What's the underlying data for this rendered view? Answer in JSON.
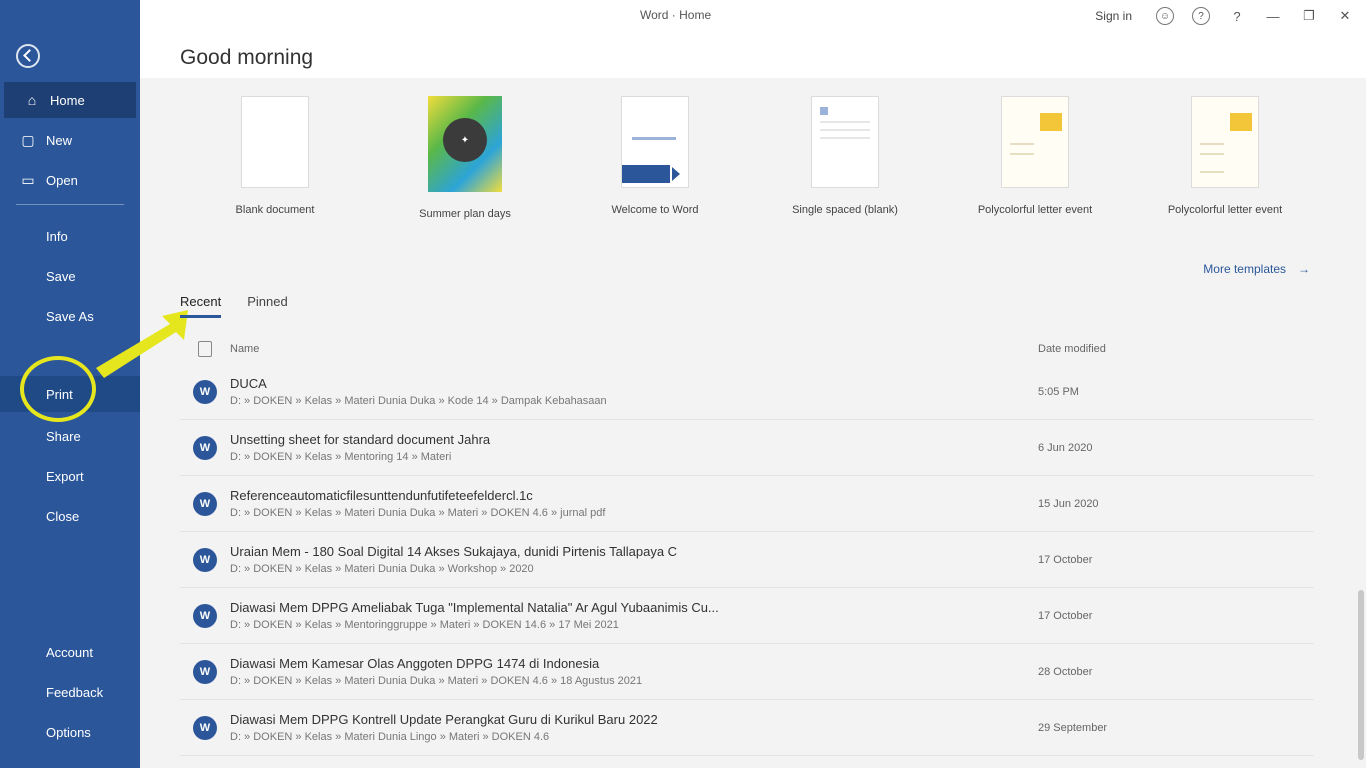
{
  "titlebar": {
    "title": "Word · Home",
    "sign_in": "Sign in",
    "icons": [
      "people-icon",
      "help-circle-icon",
      "feedback-icon",
      "minimize-icon",
      "restore-icon",
      "close-icon"
    ]
  },
  "header": {
    "greeting": "Good morning"
  },
  "sidebar": {
    "items": [
      {
        "label": "Home",
        "icon": "home-icon"
      },
      {
        "label": "New",
        "icon": "new-document-icon"
      },
      {
        "label": "Open",
        "icon": "folder-open-icon"
      },
      {
        "label": "Info"
      },
      {
        "label": "Save"
      },
      {
        "label": "Save As"
      },
      {
        "label": "Print"
      },
      {
        "label": "Share"
      },
      {
        "label": "Export"
      },
      {
        "label": "Close"
      },
      {
        "label": "Account"
      },
      {
        "label": "Feedback"
      },
      {
        "label": "Options"
      }
    ]
  },
  "templates": [
    {
      "label": "Blank document"
    },
    {
      "label": "Summer plan days"
    },
    {
      "label": "Welcome to Word"
    },
    {
      "label": "Single spaced (blank)"
    },
    {
      "label": "Polycolorful letter event"
    },
    {
      "label": "Polycolorful letter event"
    }
  ],
  "more_templates": "More templates",
  "tabs": [
    "Recent",
    "Pinned"
  ],
  "list": {
    "col_name": "Name",
    "col_date": "Date modified",
    "rows": [
      {
        "title": "DUCA",
        "path": "D: » DOKEN » Kelas » Materi Dunia Duka » Kode 14 » Dampak Kebahasaan",
        "date": "5:05 PM"
      },
      {
        "title": "Unsetting sheet for standard document Jahra",
        "path": "D: » DOKEN » Kelas » Mentoring 14 » Materi",
        "date": "6 Jun 2020"
      },
      {
        "title": "Referenceautomaticfilesunttendunfutifeteefeldercl.1c",
        "path": "D: » DOKEN » Kelas » Materi Dunia Duka » Materi » DOKEN 4.6 » jurnal pdf",
        "date": "15 Jun 2020"
      },
      {
        "title": "Uraian Mem - 180 Soal Digital 14 Akses Sukajaya, dunidi Pirtenis Tallapaya C",
        "path": "D: » DOKEN » Kelas » Materi Dunia Duka » Workshop » 2020",
        "date": "17 October"
      },
      {
        "title": "Diawasi Mem DPPG Ameliabak Tuga \"Implemental Natalia\" Ar Agul Yubaanimis Cu...",
        "path": "D: » DOKEN » Kelas » Mentoringgruppe » Materi » DOKEN 14.6 » 17 Mei 2021",
        "date": "17 October"
      },
      {
        "title": "Diawasi Mem Kamesar Olas Anggoten DPPG 1474 di Indonesia",
        "path": "D: » DOKEN » Kelas » Materi Dunia Duka » Materi » DOKEN 4.6 » 18 Agustus 2021",
        "date": "28 October"
      },
      {
        "title": "Diawasi Mem DPPG Kontrell Update Perangkat Guru di Kurikul Baru 2022",
        "path": "D: » DOKEN » Kelas » Materi Dunia Lingo » Materi » DOKEN 4.6",
        "date": "29 September"
      }
    ]
  },
  "colors": {
    "accent": "#2b579a",
    "annotation": "#e6e61e"
  }
}
